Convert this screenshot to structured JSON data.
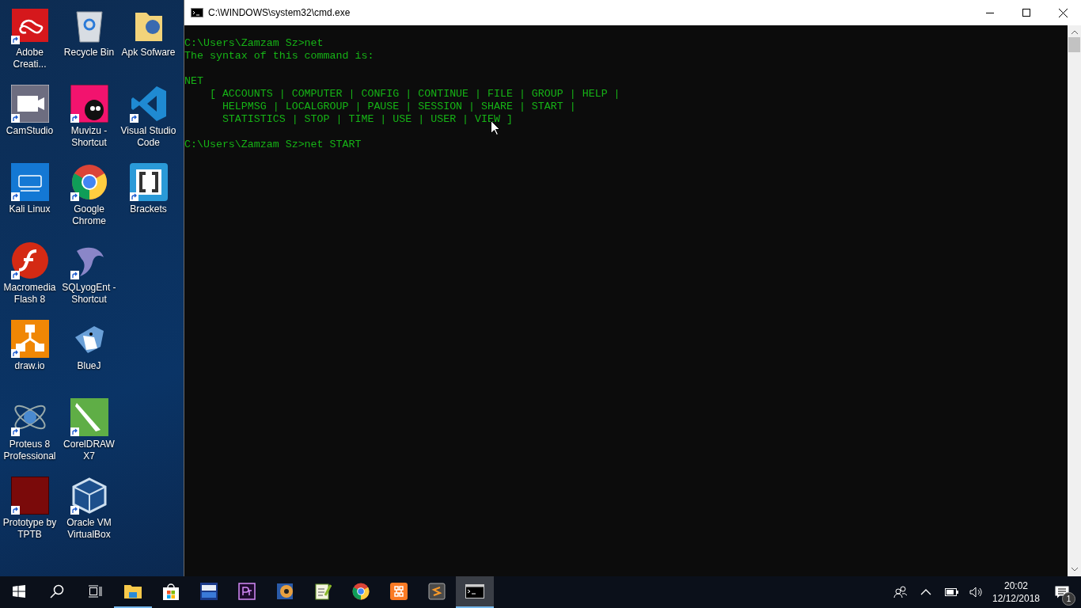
{
  "desktop": {
    "icon_columns": [
      [
        {
          "label": "Adobe Creati...",
          "kind": "adobe",
          "shortcut": true
        },
        {
          "label": "CamStudio",
          "kind": "camera",
          "shortcut": true
        },
        {
          "label": "Kali Linux",
          "kind": "kali",
          "shortcut": true
        },
        {
          "label": "Macromedia Flash 8",
          "kind": "flash",
          "shortcut": true
        },
        {
          "label": "draw.io",
          "kind": "drawio",
          "shortcut": true
        },
        {
          "label": "Proteus 8 Professional",
          "kind": "atom",
          "shortcut": true
        },
        {
          "label": "Prototype by TPTB",
          "kind": "photo",
          "shortcut": true
        }
      ],
      [
        {
          "label": "Recycle Bin",
          "kind": "recycle",
          "shortcut": false
        },
        {
          "label": "Muvizu - Shortcut",
          "kind": "muvizu",
          "shortcut": true
        },
        {
          "label": "Google Chrome",
          "kind": "chrome",
          "shortcut": true
        },
        {
          "label": "SQLyogEnt - Shortcut",
          "kind": "dolphin",
          "shortcut": true
        },
        {
          "label": "BlueJ",
          "kind": "bird",
          "shortcut": false
        },
        {
          "label": "CorelDRAW X7",
          "kind": "corel",
          "shortcut": true
        },
        {
          "label": "Oracle VM VirtualBox",
          "kind": "cube",
          "shortcut": true
        }
      ],
      [
        {
          "label": "Apk Sofware",
          "kind": "folder",
          "shortcut": false
        },
        {
          "label": "Visual Studio Code",
          "kind": "vscode",
          "shortcut": true
        },
        {
          "label": "Brackets",
          "kind": "brackets",
          "shortcut": true
        }
      ]
    ]
  },
  "window": {
    "title": "C:\\WINDOWS\\system32\\cmd.exe",
    "output_blocks": [
      [
        "C:\\Users\\Zamzam Sz>net",
        "The syntax of this command is:"
      ],
      [
        "NET",
        "    [ ACCOUNTS | COMPUTER | CONFIG | CONTINUE | FILE | GROUP | HELP |",
        "      HELPMSG | LOCALGROUP | PAUSE | SESSION | SHARE | START |",
        "      STATISTICS | STOP | TIME | USE | USER | VIEW ]"
      ],
      [
        "C:\\Users\\Zamzam Sz>net START"
      ]
    ]
  },
  "taskbar": {
    "buttons": [
      {
        "kind": "start",
        "running": false,
        "selected": false
      },
      {
        "kind": "search",
        "running": false,
        "selected": false
      },
      {
        "kind": "taskview",
        "running": false,
        "selected": false
      },
      {
        "kind": "explorer",
        "running": true,
        "selected": false
      },
      {
        "kind": "store",
        "running": false,
        "selected": false
      },
      {
        "kind": "devcpp",
        "running": false,
        "selected": false
      },
      {
        "kind": "premiere",
        "running": false,
        "selected": false
      },
      {
        "kind": "disc",
        "running": false,
        "selected": false
      },
      {
        "kind": "notepad",
        "running": false,
        "selected": false
      },
      {
        "kind": "chrome",
        "running": false,
        "selected": false
      },
      {
        "kind": "xampp",
        "running": false,
        "selected": false
      },
      {
        "kind": "sublime",
        "running": false,
        "selected": false
      },
      {
        "kind": "console",
        "running": true,
        "selected": true
      }
    ],
    "clock": {
      "time": "20:02",
      "date": "12/12/2018"
    },
    "notification_count": "1"
  }
}
